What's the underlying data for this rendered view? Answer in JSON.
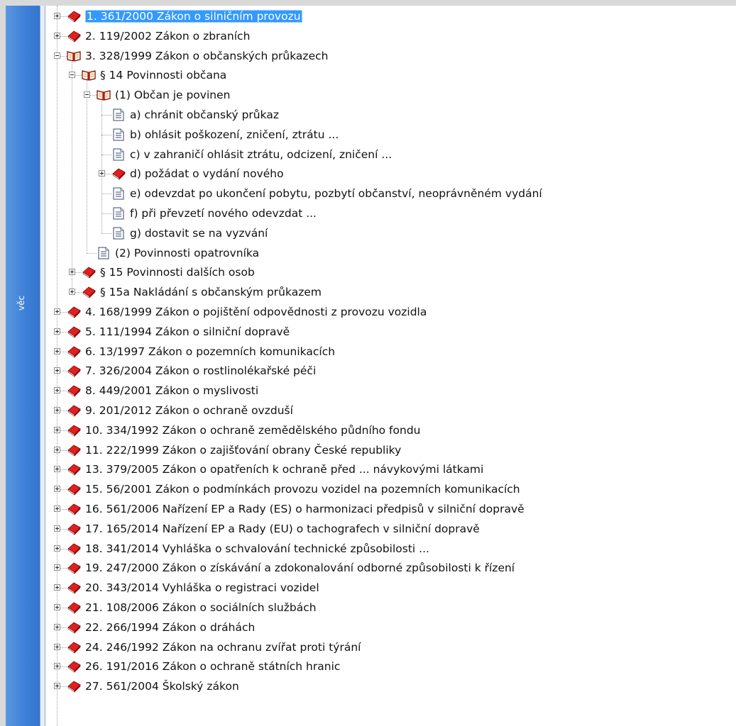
{
  "sidebar": {
    "tab_label": "věc"
  },
  "tree": [
    {
      "level": 0,
      "expander": "plus",
      "icon": "closed-book-icon",
      "label": "1.  361/2000  Zákon o silničním provozu",
      "selected": true
    },
    {
      "level": 0,
      "expander": "plus",
      "icon": "closed-book-icon",
      "label": "2.  119/2002  Zákon o zbraních"
    },
    {
      "level": 0,
      "expander": "minus",
      "icon": "open-book-icon",
      "label": "3.  328/1999  Zákon o občanských průkazech"
    },
    {
      "level": 1,
      "expander": "minus",
      "icon": "open-book-icon",
      "label": "§ 14  Povinnosti občana"
    },
    {
      "level": 2,
      "expander": "minus",
      "icon": "open-book-icon",
      "label": "(1)  Občan je povinen"
    },
    {
      "level": 3,
      "expander": "none",
      "icon": "document-icon",
      "label": "a)  chránit občanský  průkaz"
    },
    {
      "level": 3,
      "expander": "none",
      "icon": "document-icon",
      "label": "b)  ohlásit poškození, zničení, ztrátu ..."
    },
    {
      "level": 3,
      "expander": "none",
      "icon": "document-icon",
      "label": "c)  v zahraničí ohlásit ztrátu, odcizení, zničení ..."
    },
    {
      "level": 3,
      "expander": "plus",
      "icon": "closed-book-icon",
      "label": "d)  požádat o vydání nového"
    },
    {
      "level": 3,
      "expander": "none",
      "icon": "document-icon",
      "label": "e)  odevzdat po ukončení pobytu, pozbytí občanství, neoprávněném vydání"
    },
    {
      "level": 3,
      "expander": "none",
      "icon": "document-icon",
      "label": "f)  při převzetí nového odevzdat ..."
    },
    {
      "level": 3,
      "expander": "none",
      "icon": "document-icon",
      "label": "g)  dostavit se na vyzvání"
    },
    {
      "level": 2,
      "expander": "none",
      "icon": "document-icon",
      "label": "(2)  Povinnosti opatrovníka"
    },
    {
      "level": 1,
      "expander": "plus",
      "icon": "closed-book-icon",
      "label": "§ 15  Povinnosti dalších osob"
    },
    {
      "level": 1,
      "expander": "plus",
      "icon": "closed-book-icon",
      "label": "§ 15a  Nakládání s občanským průkazem"
    },
    {
      "level": 0,
      "expander": "plus",
      "icon": "closed-book-icon",
      "label": "4.  168/1999  Zákon o pojištění odpovědnosti z provozu vozidla"
    },
    {
      "level": 0,
      "expander": "plus",
      "icon": "closed-book-icon",
      "label": "5.  111/1994  Zákon o silniční dopravě"
    },
    {
      "level": 0,
      "expander": "plus",
      "icon": "closed-book-icon",
      "label": "6.    13/1997  Zákon o pozemních komunikacích"
    },
    {
      "level": 0,
      "expander": "plus",
      "icon": "closed-book-icon",
      "label": "7.  326/2004  Zákon o rostlinolékařské péči"
    },
    {
      "level": 0,
      "expander": "plus",
      "icon": "closed-book-icon",
      "label": "8.  449/2001  Zákon o myslivosti"
    },
    {
      "level": 0,
      "expander": "plus",
      "icon": "closed-book-icon",
      "label": "9.  201/2012  Zákon o ochraně ovzduší"
    },
    {
      "level": 0,
      "expander": "plus",
      "icon": "closed-book-icon",
      "label": "10.  334/1992  Zákon o ochraně zemědělského půdního fondu"
    },
    {
      "level": 0,
      "expander": "plus",
      "icon": "closed-book-icon",
      "label": "11.  222/1999  Zákon o zajišťování obrany České republiky"
    },
    {
      "level": 0,
      "expander": "plus",
      "icon": "closed-book-icon",
      "label": "13.  379/2005  Zákon o opatřeních k ochraně před ... návykovými látkami"
    },
    {
      "level": 0,
      "expander": "plus",
      "icon": "closed-book-icon",
      "label": "15.    56/2001  Zákon o podmínkách provozu vozidel na pozemních komunikacích"
    },
    {
      "level": 0,
      "expander": "plus",
      "icon": "closed-book-icon",
      "label": "16.  561/2006  Nařízení EP a Rady (ES) o harmonizaci předpisů v silniční dopravě"
    },
    {
      "level": 0,
      "expander": "plus",
      "icon": "closed-book-icon",
      "label": "17.  165/2014  Nařízení EP a Rady (EU) o tachografech v silniční dopravě"
    },
    {
      "level": 0,
      "expander": "plus",
      "icon": "closed-book-icon",
      "label": "18.  341/2014  Vyhláška o schvalování technické způsobilosti ..."
    },
    {
      "level": 0,
      "expander": "plus",
      "icon": "closed-book-icon",
      "label": "19.  247/2000  Zákon o získávání a zdokonalování odborné způsobilosti k řízení"
    },
    {
      "level": 0,
      "expander": "plus",
      "icon": "closed-book-icon",
      "label": "20.  343/2014  Vyhláška o registraci vozidel"
    },
    {
      "level": 0,
      "expander": "plus",
      "icon": "closed-book-icon",
      "label": "21.  108/2006  Zákon o sociálních službách"
    },
    {
      "level": 0,
      "expander": "plus",
      "icon": "closed-book-icon",
      "label": "22.  266/1994  Zákon o dráhách"
    },
    {
      "level": 0,
      "expander": "plus",
      "icon": "closed-book-icon",
      "label": "24.  246/1992  Zákon na ochranu zvířat proti týrání"
    },
    {
      "level": 0,
      "expander": "plus",
      "icon": "closed-book-icon",
      "label": "26.  191/2016  Zákon o ochraně státních hranic"
    },
    {
      "level": 0,
      "expander": "plus",
      "icon": "closed-book-icon",
      "label": "27.  561/2004  Školský zákon"
    }
  ]
}
